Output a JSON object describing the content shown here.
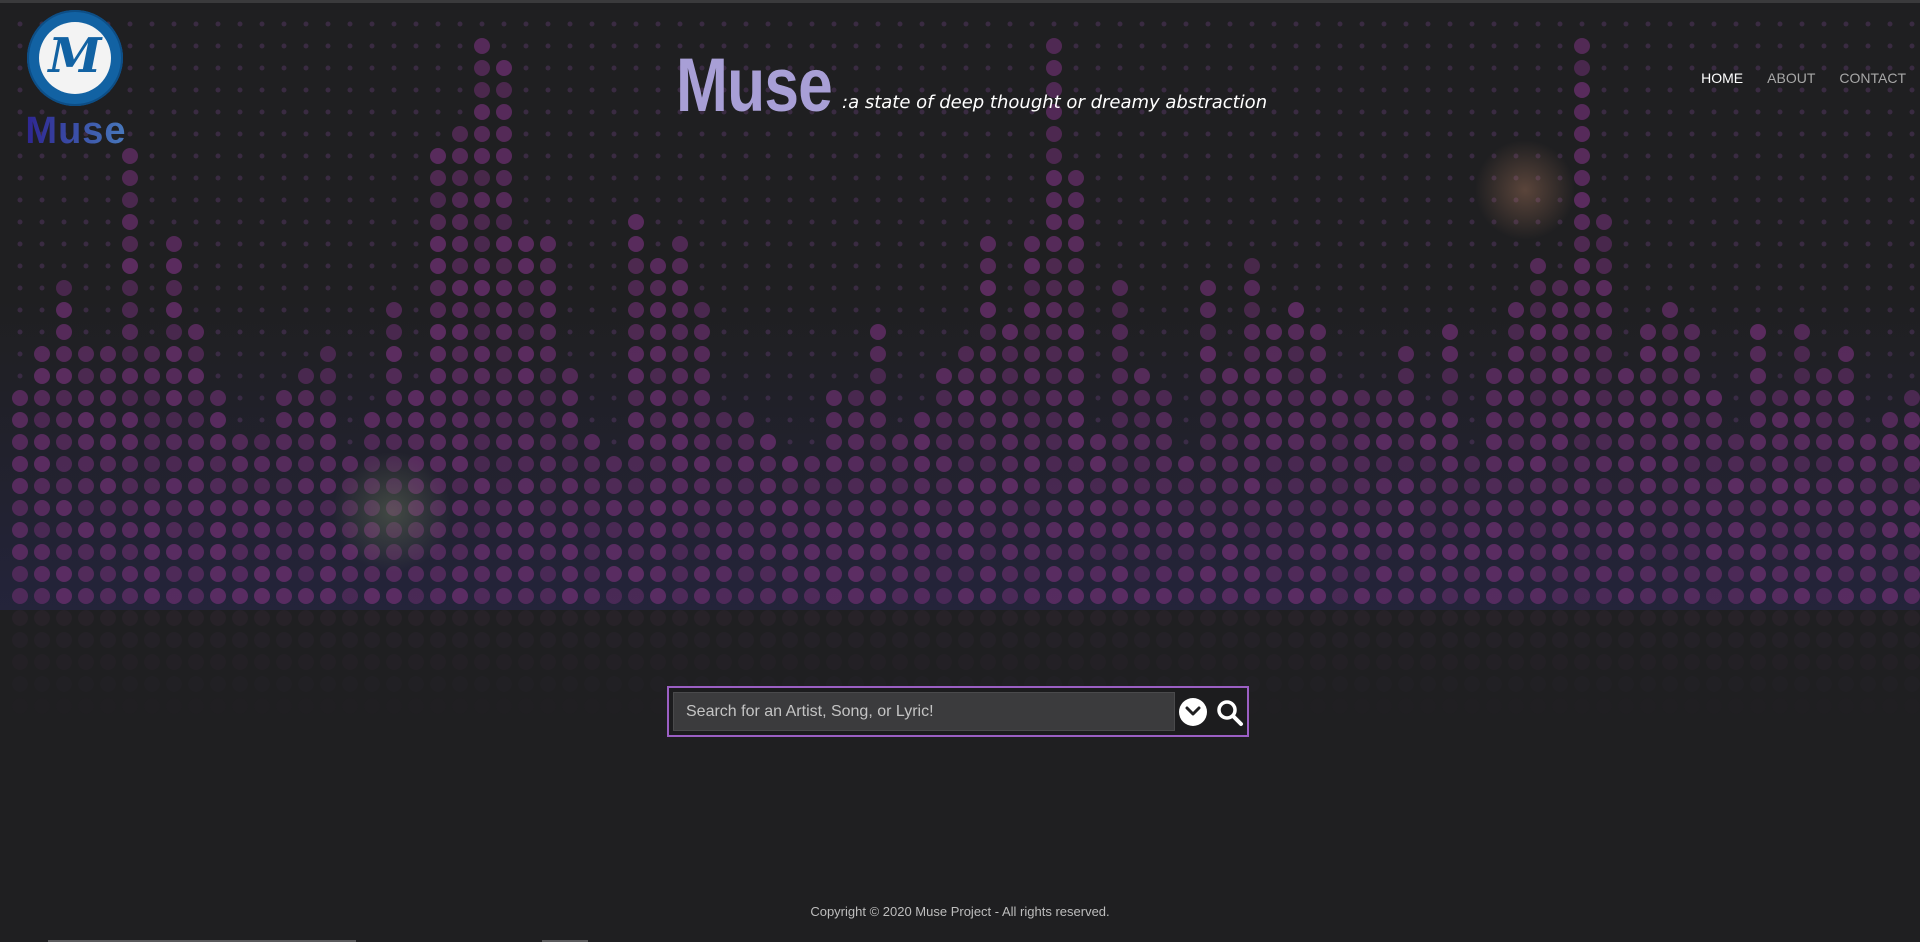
{
  "logo": {
    "letter": "M",
    "text": "Muse"
  },
  "brand": {
    "title": "Muse",
    "tagline": ":a state of deep thought or dreamy abstraction"
  },
  "nav": {
    "items": [
      {
        "label": "HOME",
        "active": true
      },
      {
        "label": "ABOUT",
        "active": false
      },
      {
        "label": "CONTACT",
        "active": false
      }
    ]
  },
  "search": {
    "placeholder": "Search for an Artist, Song, or Lyric!",
    "value": ""
  },
  "footer": {
    "copyright": "Copyright © 2020 Muse Project - All rights reserved."
  },
  "colors": {
    "background": "#1f1f21",
    "accent": "#9b5fc4",
    "brand": "#a89fd6",
    "logo_blue": "#1262a3",
    "dots": "#6a2f6e"
  }
}
